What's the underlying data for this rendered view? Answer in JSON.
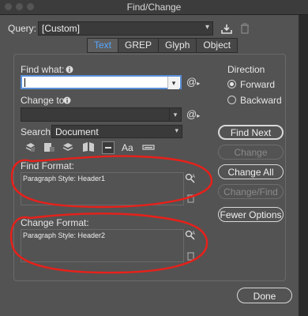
{
  "window": {
    "title": "Find/Change"
  },
  "query": {
    "label": "Query:",
    "value": "[Custom]"
  },
  "tabs": [
    {
      "label": "Text",
      "active": true
    },
    {
      "label": "GREP",
      "active": false
    },
    {
      "label": "Glyph",
      "active": false
    },
    {
      "label": "Object",
      "active": false
    }
  ],
  "find_what": {
    "label": "Find what:",
    "value": ""
  },
  "change_to": {
    "label": "Change to:",
    "value": ""
  },
  "search": {
    "label": "Search:",
    "value": "Document"
  },
  "special_char_symbol": "@",
  "direction": {
    "label": "Direction",
    "options": [
      {
        "label": "Forward",
        "selected": true
      },
      {
        "label": "Backward",
        "selected": false
      }
    ]
  },
  "buttons": {
    "find_next": "Find Next",
    "change": "Change",
    "change_all": "Change All",
    "change_find": "Change/Find",
    "fewer_options": "Fewer Options",
    "done": "Done"
  },
  "find_format": {
    "label": "Find Format:",
    "value": "Paragraph Style: Header1"
  },
  "change_format": {
    "label": "Change Format:",
    "value": "Paragraph Style: Header2"
  },
  "colors": {
    "accent": "#55a7ff",
    "annotation": "#e8201a",
    "panel": "#535353"
  }
}
